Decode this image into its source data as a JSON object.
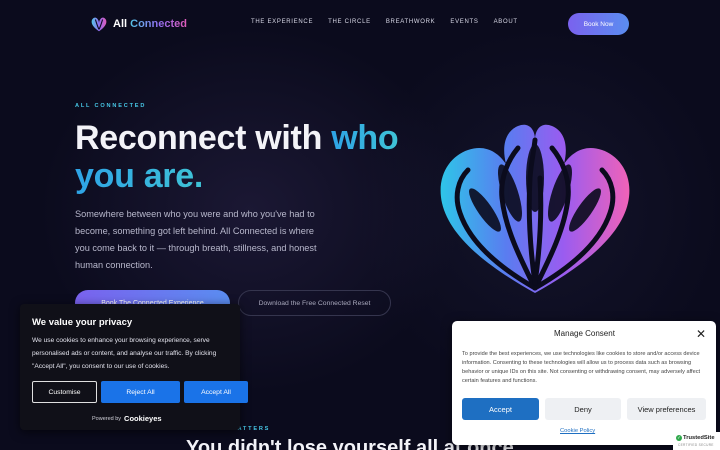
{
  "header": {
    "logo_word1": "All",
    "logo_word2": "Connected",
    "nav": [
      "THE EXPERIENCE",
      "THE CIRCLE",
      "BREATHWORK",
      "EVENTS",
      "ABOUT"
    ],
    "book_label": "Book Now"
  },
  "hero": {
    "eyebrow": "ALL CONNECTED",
    "headline_part1": "Reconnect with",
    "headline_part2": "who",
    "headline_part3": "you are.",
    "description": "Somewhere between who you were and who you've had to become, something got left behind. All Connected is where you come back to it — through breath, stillness, and honest human connection.",
    "cta_primary": "Book The Connected Experience",
    "cta_secondary": "Download the Free Connected Reset"
  },
  "section": {
    "eyebrow": "WHY THIS MATTERS",
    "heading": "You didn't lose yourself all at once."
  },
  "cookie_banner": {
    "title": "We value your privacy",
    "body": "We use cookies to enhance your browsing experience, serve personalised ads or content, and analyse our traffic. By clicking \"Accept All\", you consent to our use of cookies.",
    "customise": "Customise",
    "reject": "Reject All",
    "accept": "Accept All",
    "powered_by": "Powered by",
    "brand": "Cookieyes"
  },
  "consent_modal": {
    "title": "Manage Consent",
    "body": "To provide the best experiences, we use technologies like cookies to store and/or access device information. Consenting to these technologies will allow us to process data such as browsing behavior or unique IDs on this site. Not consenting or withdrawing consent, may adversely affect certain features and functions.",
    "accept": "Accept",
    "deny": "Deny",
    "preferences": "View preferences",
    "policy_link": "Cookie Policy",
    "close_icon": "close-icon"
  },
  "trusted_badge": {
    "name": "TrustedSite",
    "sub": "CERTIFIED SECURE"
  },
  "colors": {
    "background": "#0b0b1d",
    "accent_cyan": "#47c7e6",
    "button_gradient_start": "#7a62ee",
    "button_gradient_end": "#5a8df0",
    "cookie_blue": "#1a73e8",
    "consent_blue": "#1e6fc2"
  }
}
